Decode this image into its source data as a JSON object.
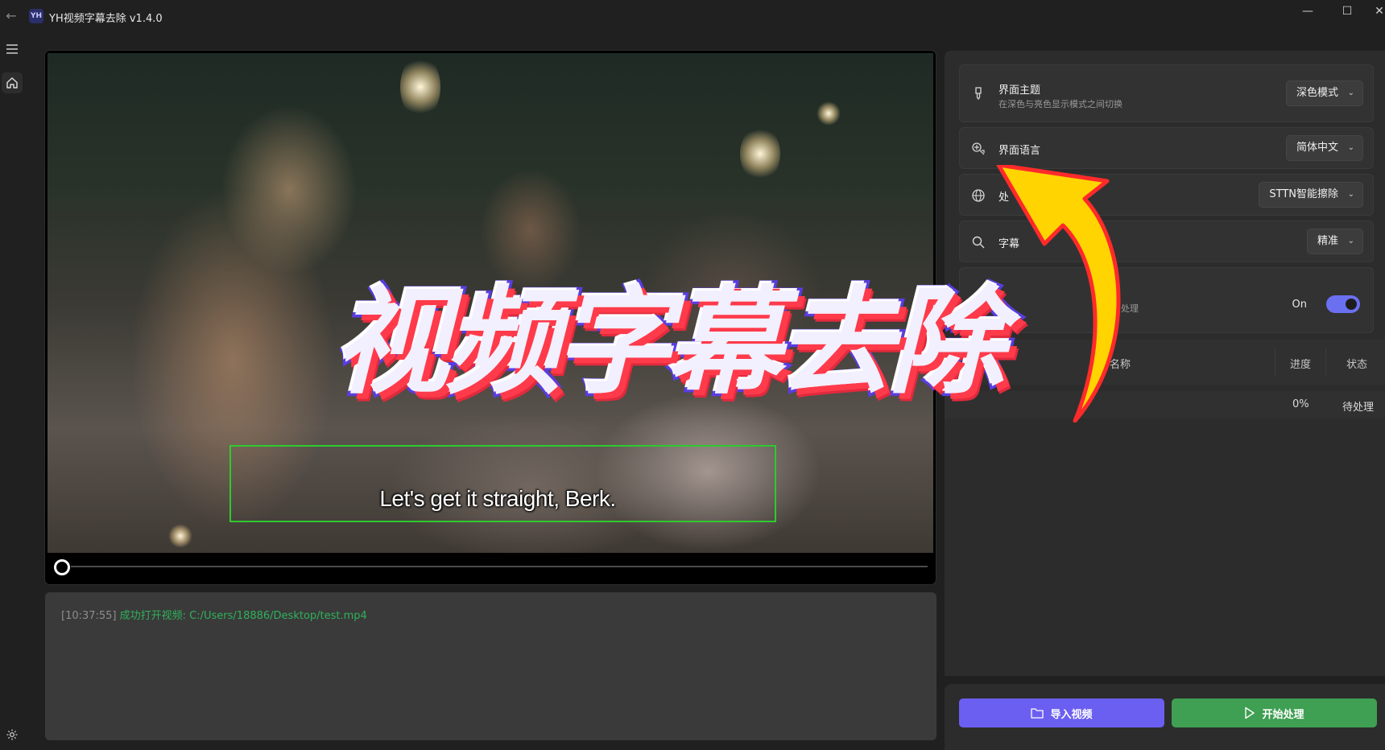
{
  "titlebar": {
    "back_icon": "arrow-left-icon",
    "logo_text": "YH",
    "title": "YH视频字幕去除 v1.4.0",
    "minimize": "—",
    "maximize": "☐",
    "close": "✕"
  },
  "rail": {
    "menu_icon": "hamburger-icon",
    "home_icon": "home-icon",
    "settings_icon": "gear-icon"
  },
  "video": {
    "subtitle": "Let's get it straight, Berk.",
    "progress": 0.0,
    "region_color": "#2ecb2e"
  },
  "log": {
    "time": "[10:37:55]",
    "message": "成功打开视频: C:/Users/18886/Desktop/test.mp4"
  },
  "settings": {
    "theme": {
      "icon": "brush-icon",
      "label": "界面主题",
      "desc": "在深色与亮色显示模式之间切换",
      "value": "深色模式"
    },
    "language": {
      "icon": "translate-icon",
      "label": "界面语言",
      "value": "简体中文"
    },
    "mode": {
      "icon": "globe-icon",
      "label": "处",
      "value": "STTN智能擦除"
    },
    "detect": {
      "icon": "search-icon",
      "label": "字幕",
      "value": "精准"
    },
    "toggle": {
      "desc_fragment": "处理",
      "state_label": "On",
      "on": true,
      "accent": "#6b70f0"
    }
  },
  "table": {
    "headers": {
      "name": "名称",
      "progress": "进度",
      "status": "状态"
    },
    "rows": [
      {
        "progress": "0%",
        "status": "待处理"
      }
    ]
  },
  "actions": {
    "import_label": "导入视频",
    "import_icon": "folder-icon",
    "start_label": "开始处理",
    "start_icon": "play-icon",
    "import_color": "#6b5ff2",
    "start_color": "#3f9f52"
  },
  "promo": {
    "banner": "视频字幕去除",
    "arrow_icon": "curved-arrow-icon"
  }
}
